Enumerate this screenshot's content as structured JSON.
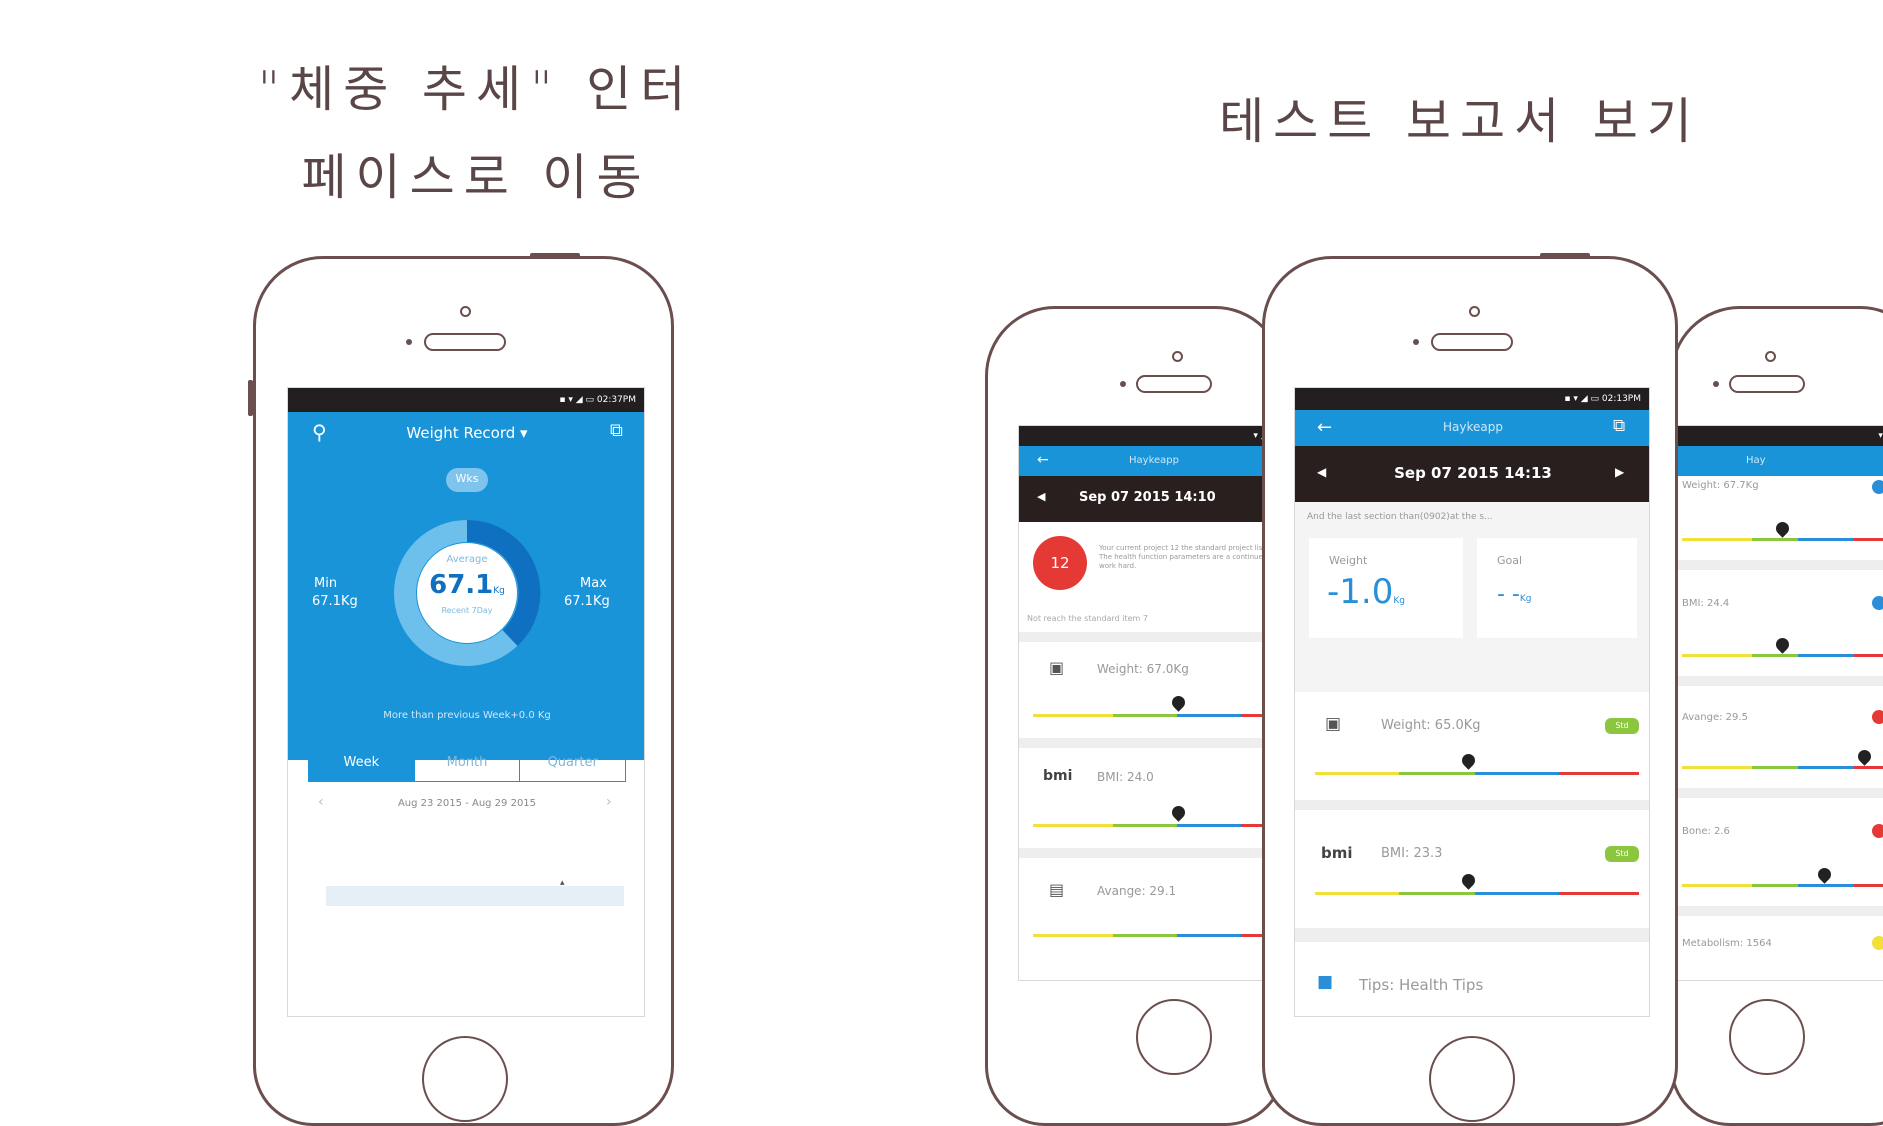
{
  "captions": {
    "left_line1": "\"체중 추세\" 인터",
    "left_line2": "페이스로 이동",
    "right": "테스트 보고서 보기"
  },
  "colors": {
    "frame": "#6b4e4e",
    "app_blue": "#1a94d8",
    "header_dark": "#2a1f1f",
    "red": "#e53935",
    "green": "#8cc63f",
    "yellow": "#f2e03a",
    "scale_blue": "#2a8fd8"
  },
  "weight_record": {
    "nav_title": "Weight Record ▾",
    "pill": "Wks",
    "min_label": "Min",
    "min_value": "67.1Kg",
    "max_label": "Max",
    "max_value": "67.1Kg",
    "center_label": "Average",
    "center_value": "67.1",
    "center_unit": "Kg",
    "center_sub": "Recent 7Day",
    "summary": "More than previous Week+0.0 Kg",
    "tabs": [
      "Week",
      "Month",
      "Quarter"
    ],
    "date_range": "Aug 23 2015 - Aug 29 2015"
  },
  "report_left": {
    "nav_title": "Haykeapp",
    "date": "Sep 07 2015 14:10",
    "score": "12",
    "score_text": "Your current project 12 the standard project list. The health function parameters are a continue to work hard.",
    "section_title": "Not reach the standard item 7",
    "rows": [
      {
        "icon": "▣",
        "label": "Weight: 67.0Kg"
      },
      {
        "icon": "bmi",
        "label": "BMI: 24.0"
      },
      {
        "icon": "▤",
        "label": "Avange: 29.1"
      }
    ]
  },
  "report_center": {
    "nav_title": "Haykeapp",
    "date": "Sep 07 2015 14:13",
    "intro": "And the last section than(0902)at the s...",
    "weight_label": "Weight",
    "weight_value": "-1.0",
    "weight_unit": "Kg",
    "goal_label": "Goal",
    "goal_value": "- -",
    "goal_unit": "Kg",
    "rows": [
      {
        "icon": "▣",
        "label": "Weight: 65.0Kg",
        "badge": "Std"
      },
      {
        "icon": "bmi",
        "label": "BMI: 23.3",
        "badge": "Std"
      }
    ],
    "tips": "Tips: Health Tips"
  },
  "report_right": {
    "nav_title": "Hay",
    "rows": [
      {
        "label": "Weight: 67.7Kg"
      },
      {
        "label": "BMI: 24.4"
      },
      {
        "label": "Avange: 29.5"
      },
      {
        "label": "Bone: 2.6"
      },
      {
        "label": "Metabolism: 1564"
      }
    ]
  }
}
